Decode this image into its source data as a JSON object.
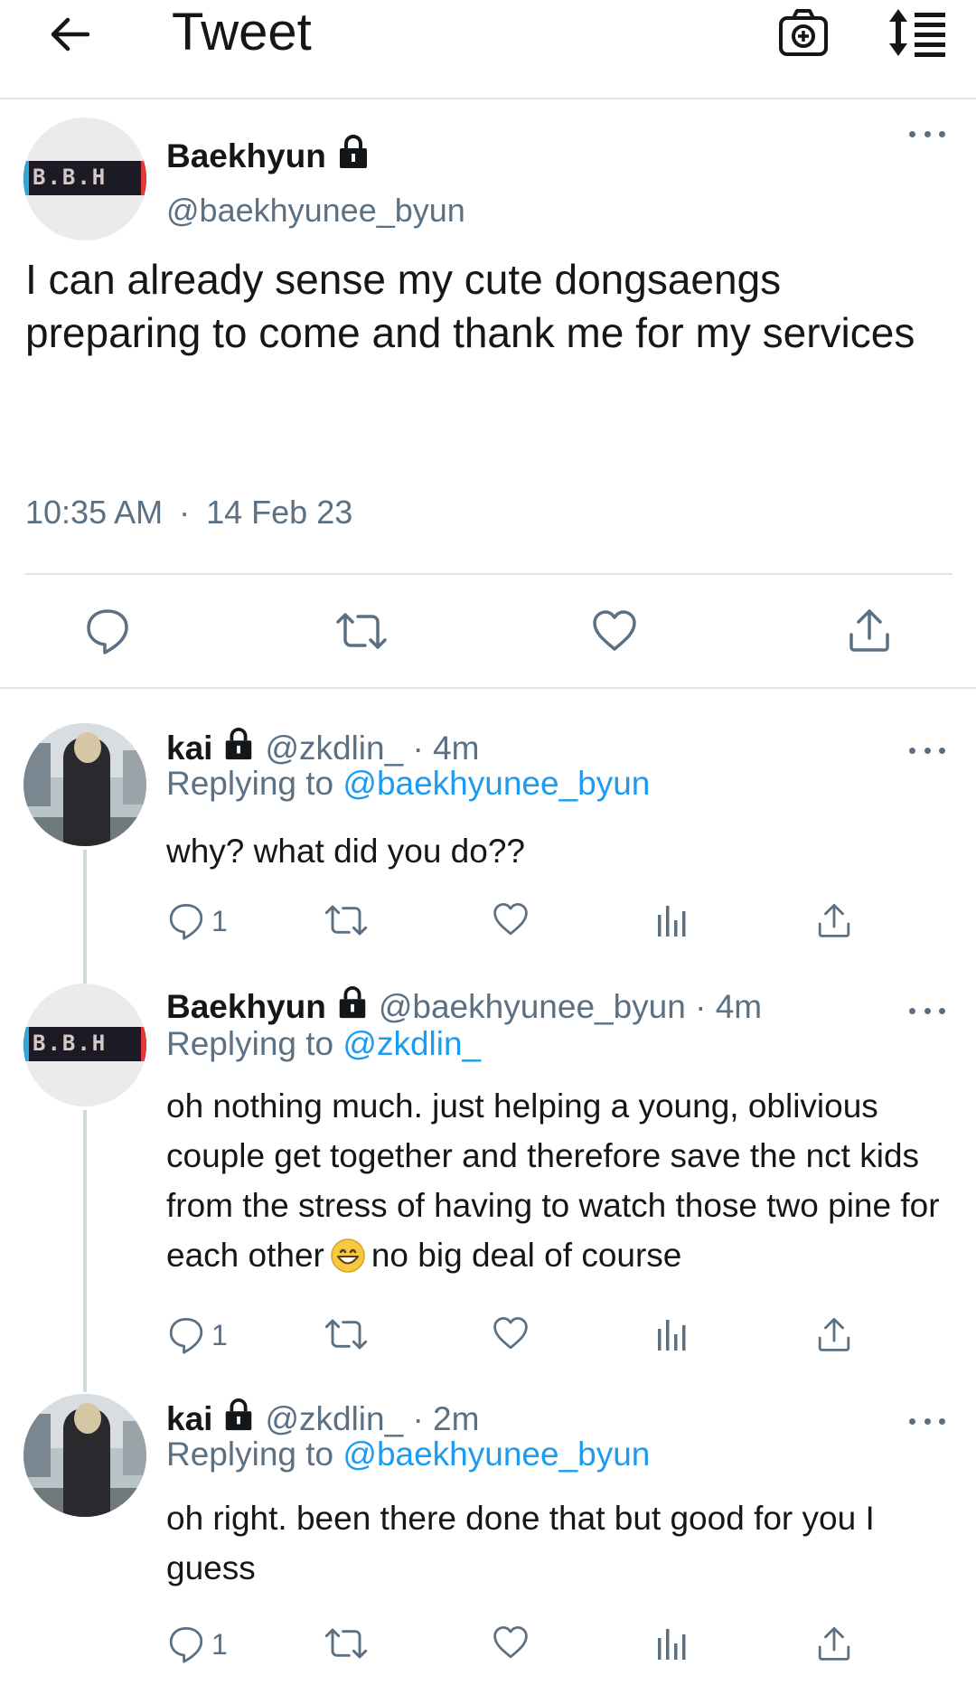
{
  "header": {
    "title": "Tweet"
  },
  "main_tweet": {
    "author_name": "Baekhyun",
    "author_handle": "@baekhyunee_byun",
    "avatar_text": "B.B.H",
    "text": "I can already sense my cute dongsaengs preparing to come and thank me for my services",
    "time": "10:35 AM",
    "dot": "·",
    "date": "14 Feb 23"
  },
  "replies": [
    {
      "author_name": "kai",
      "meta": "@zkdlin_ · 4m",
      "replying_prefix": "Replying to",
      "replying_to": "@baekhyunee_byun",
      "text": "why? what did you do??",
      "reply_count": "1"
    },
    {
      "author_name": "Baekhyun",
      "avatar_text": "B.B.H",
      "meta": "@baekhyunee_byun · 4m",
      "replying_prefix": "Replying to",
      "replying_to": "@zkdlin_",
      "text_before_emoji": "oh nothing much. just helping a young, oblivious couple get together and therefore save the nct kids from the stress of having to watch those two pine for each other",
      "emoji": "grinning-face-emoji",
      "text_after_emoji": "no big deal of course",
      "reply_count": "1"
    },
    {
      "author_name": "kai",
      "meta": "@zkdlin_ · 2m",
      "replying_prefix": "Replying to",
      "replying_to": "@baekhyunee_byun",
      "text": "oh right. been there done that but good for you I guess",
      "reply_count": "1"
    }
  ],
  "colors": {
    "text_primary": "#14171a",
    "text_secondary": "#5b7083",
    "link": "#1d9bf0",
    "divider": "#e1e4e6"
  },
  "icons": [
    "back-arrow-icon",
    "camera-icon",
    "sort-icon",
    "lock-icon",
    "more-icon",
    "reply-icon",
    "retweet-icon",
    "like-icon",
    "analytics-icon",
    "share-icon"
  ]
}
